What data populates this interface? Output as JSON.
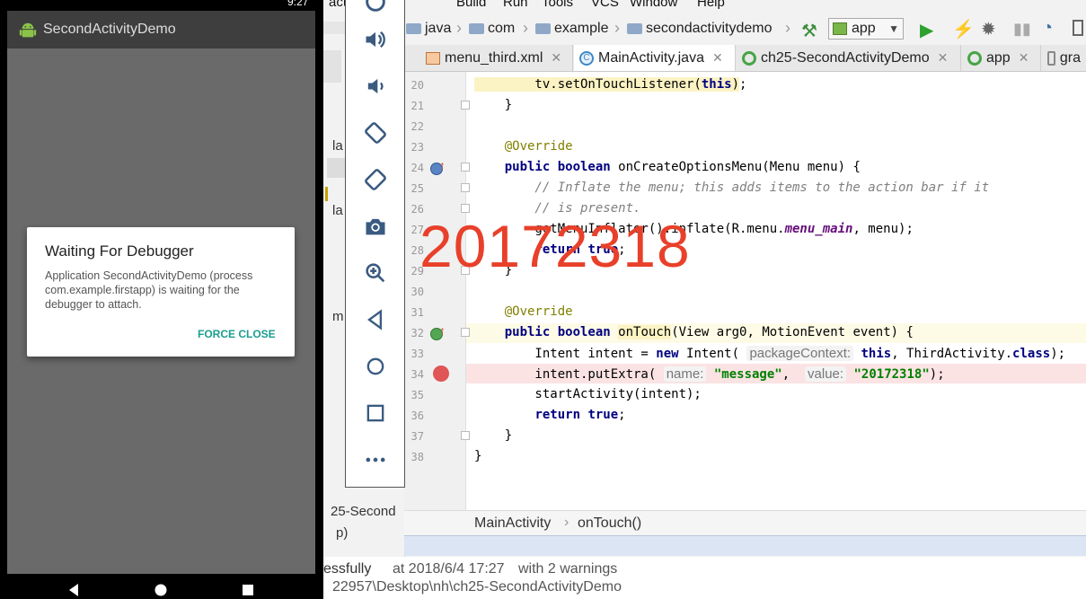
{
  "ide": {
    "menu": [
      "actor",
      "Build",
      "Run",
      "Tools",
      "VCS",
      "Window",
      "Help"
    ],
    "breadcrumbs": [
      "java",
      "com",
      "example",
      "secondactivitydemo"
    ],
    "run_config": "app",
    "tabs": [
      "menu_third.xml",
      "MainActivity.java",
      "ch25-SecondActivityDemo",
      "app",
      "gra"
    ],
    "left_panel": {
      "label_la1": "la",
      "label_la2": "la",
      "label_m": "m",
      "bottom_1": "25-Second",
      "bottom_2": "p)"
    },
    "editor": {
      "line_numbers": [
        "20",
        "21",
        "22",
        "23",
        "24",
        "25",
        "26",
        "27",
        "28",
        "29",
        "30",
        "31",
        "32",
        "33",
        "34",
        "35",
        "36",
        "37",
        "38"
      ],
      "hint_package_context": "packageContext:",
      "hint_name": "name:",
      "hint_value": "value:"
    },
    "structure_breadcrumb": [
      "MainActivity",
      "onTouch()"
    ],
    "build_status": {
      "result": "essfully",
      "time": "at 2018/6/4 17:27",
      "warnings": "with 2 warnings",
      "path": "22957\\Desktop\\nh\\ch25-SecondActivityDemo"
    }
  },
  "watermark": "20172318",
  "emulator_toolbar": [
    "power-icon",
    "volume-up-icon",
    "volume-down-icon",
    "rotate-left-icon",
    "rotate-right-icon",
    "camera-icon",
    "zoom-icon",
    "back-icon",
    "home-icon",
    "overview-icon",
    "more-icon"
  ],
  "phone": {
    "clock": "9:27",
    "app_title": "SecondActivityDemo",
    "dialog": {
      "title": "Waiting For Debugger",
      "message": "Application SecondActivityDemo (process com.example.firstapp) is waiting for the debugger to attach.",
      "button": "FORCE CLOSE"
    }
  },
  "colors": {
    "watermark": "#e8402a",
    "dialog_button": "#1a9e8f",
    "breakpoint": "#e05555",
    "breakpoint_line": "#fbe3e4",
    "keyword": "#000080",
    "string": "#008000"
  }
}
